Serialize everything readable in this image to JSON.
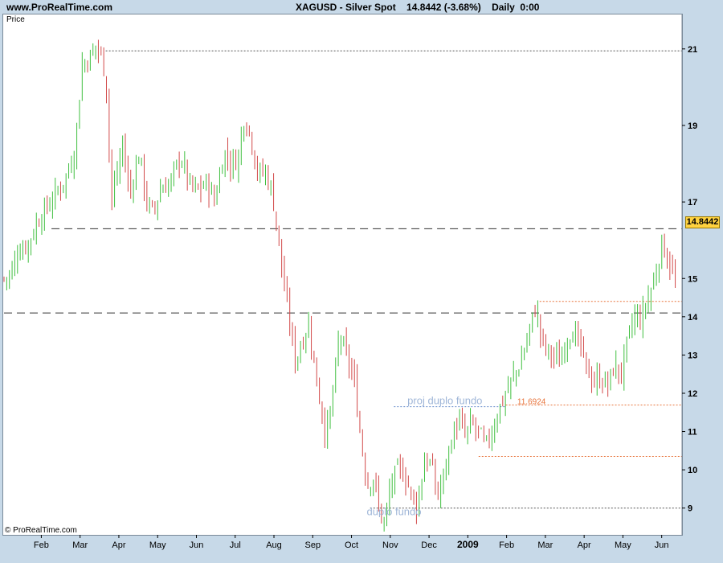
{
  "header": {
    "site": "www.ProRealTime.com",
    "title": "XAGUSD - Silver Spot    14.8442 (-3.68%)    Daily  0:00"
  },
  "panel": {
    "price_label": "Price",
    "copyright": "© ProRealTime.com",
    "last_price": "14.8442"
  },
  "chart_data": {
    "type": "bar",
    "instrument": "XAGUSD - Silver Spot",
    "last": 14.8442,
    "change_pct": -3.68,
    "timeframe": "Daily",
    "y_ticks": [
      21,
      19,
      17,
      15,
      14,
      13,
      12,
      11,
      10,
      9
    ],
    "ylim": [
      8.3,
      21.9
    ],
    "x_ticks": [
      "Feb",
      "Mar",
      "Apr",
      "May",
      "Jun",
      "Jul",
      "Aug",
      "Sep",
      "Oct",
      "Nov",
      "Dec",
      "2009",
      "Feb",
      "Mar",
      "Apr",
      "May",
      "Jun"
    ],
    "horizontal_lines": [
      {
        "value": 20.95,
        "style": "dotted",
        "color": "#555555",
        "from_pct": 0.15
      },
      {
        "value": 16.3,
        "style": "dashed",
        "color": "#333333",
        "from_pct": 0.07
      },
      {
        "value": 14.1,
        "style": "dashed",
        "color": "#333333",
        "from_pct": 0.0
      },
      {
        "value": 14.4,
        "style": "dotted",
        "color": "#e8743c",
        "from_pct": 0.79
      },
      {
        "value": 11.6924,
        "style": "dotted",
        "color": "#e8743c",
        "from_pct": 0.74
      },
      {
        "value": 11.65,
        "style": "dotted",
        "color": "#6a8fcc",
        "from_pct": 0.575,
        "to_pct": 0.74
      },
      {
        "value": 10.35,
        "style": "dotted",
        "color": "#e8743c",
        "from_pct": 0.7
      },
      {
        "value": 9.0,
        "style": "dotted",
        "color": "#555555",
        "from_pct": 0.54
      }
    ],
    "annotations": [
      {
        "text": "proj duplo fundo",
        "value": 11.72,
        "color": "#9fb6d8",
        "anchor_pct": 0.595
      },
      {
        "text": "11.6924",
        "value": 11.72,
        "color": "#e8743c",
        "anchor_pct": 0.757
      },
      {
        "text": "duplo fundo",
        "value": 8.82,
        "color": "#9fb6d8",
        "anchor_pct": 0.535
      }
    ],
    "series": [
      {
        "colors": {
          "up": "#3fbf3f",
          "down": "#d24a4a"
        },
        "close_path": [
          [
            0,
            15.0
          ],
          [
            0.01,
            15.1
          ],
          [
            0.02,
            15.7
          ],
          [
            0.035,
            15.9
          ],
          [
            0.05,
            16.5
          ],
          [
            0.065,
            16.9
          ],
          [
            0.08,
            17.3
          ],
          [
            0.095,
            17.8
          ],
          [
            0.105,
            18.4
          ],
          [
            0.115,
            20.6
          ],
          [
            0.125,
            20.7
          ],
          [
            0.135,
            21.1
          ],
          [
            0.145,
            20.8
          ],
          [
            0.152,
            19.8
          ],
          [
            0.158,
            17.0
          ],
          [
            0.165,
            17.6
          ],
          [
            0.175,
            18.5
          ],
          [
            0.185,
            17.2
          ],
          [
            0.2,
            18.3
          ],
          [
            0.21,
            17.0
          ],
          [
            0.22,
            16.7
          ],
          [
            0.23,
            17.3
          ],
          [
            0.245,
            17.5
          ],
          [
            0.26,
            18.2
          ],
          [
            0.275,
            17.4
          ],
          [
            0.285,
            17.3
          ],
          [
            0.3,
            17.5
          ],
          [
            0.31,
            17.0
          ],
          [
            0.325,
            18.3
          ],
          [
            0.335,
            18.0
          ],
          [
            0.345,
            18.1
          ],
          [
            0.355,
            19.3
          ],
          [
            0.365,
            18.6
          ],
          [
            0.375,
            17.7
          ],
          [
            0.385,
            17.8
          ],
          [
            0.395,
            17.3
          ],
          [
            0.405,
            16.0
          ],
          [
            0.415,
            14.5
          ],
          [
            0.42,
            14.0
          ],
          [
            0.43,
            12.8
          ],
          [
            0.44,
            13.4
          ],
          [
            0.45,
            13.8
          ],
          [
            0.46,
            12.4
          ],
          [
            0.47,
            11.4
          ],
          [
            0.475,
            10.8
          ],
          [
            0.485,
            12.0
          ],
          [
            0.495,
            13.6
          ],
          [
            0.505,
            12.9
          ],
          [
            0.515,
            12.5
          ],
          [
            0.525,
            11.0
          ],
          [
            0.535,
            9.6
          ],
          [
            0.545,
            9.8
          ],
          [
            0.555,
            8.8
          ],
          [
            0.562,
            8.6
          ],
          [
            0.57,
            9.6
          ],
          [
            0.58,
            10.0
          ],
          [
            0.59,
            9.9
          ],
          [
            0.6,
            9.4
          ],
          [
            0.61,
            9.0
          ],
          [
            0.62,
            10.3
          ],
          [
            0.63,
            10.1
          ],
          [
            0.64,
            9.3
          ],
          [
            0.65,
            10.0
          ],
          [
            0.66,
            10.8
          ],
          [
            0.67,
            11.3
          ],
          [
            0.68,
            10.9
          ],
          [
            0.69,
            11.2
          ],
          [
            0.7,
            11.0
          ],
          [
            0.71,
            10.6
          ],
          [
            0.72,
            11.0
          ],
          [
            0.73,
            11.6
          ],
          [
            0.74,
            12.0
          ],
          [
            0.75,
            12.4
          ],
          [
            0.76,
            12.7
          ],
          [
            0.77,
            13.3
          ],
          [
            0.775,
            13.7
          ],
          [
            0.785,
            14.3
          ],
          [
            0.79,
            13.6
          ],
          [
            0.8,
            13.1
          ],
          [
            0.81,
            13.0
          ],
          [
            0.82,
            12.8
          ],
          [
            0.83,
            13.5
          ],
          [
            0.84,
            13.6
          ],
          [
            0.85,
            13.2
          ],
          [
            0.86,
            12.6
          ],
          [
            0.87,
            12.3
          ],
          [
            0.88,
            12.4
          ],
          [
            0.89,
            12.2
          ],
          [
            0.9,
            12.7
          ],
          [
            0.91,
            12.5
          ],
          [
            0.92,
            13.4
          ],
          [
            0.93,
            14.0
          ],
          [
            0.94,
            13.9
          ],
          [
            0.95,
            14.5
          ],
          [
            0.96,
            15.0
          ],
          [
            0.97,
            15.9
          ],
          [
            0.98,
            15.5
          ],
          [
            0.99,
            14.85
          ]
        ]
      }
    ]
  }
}
